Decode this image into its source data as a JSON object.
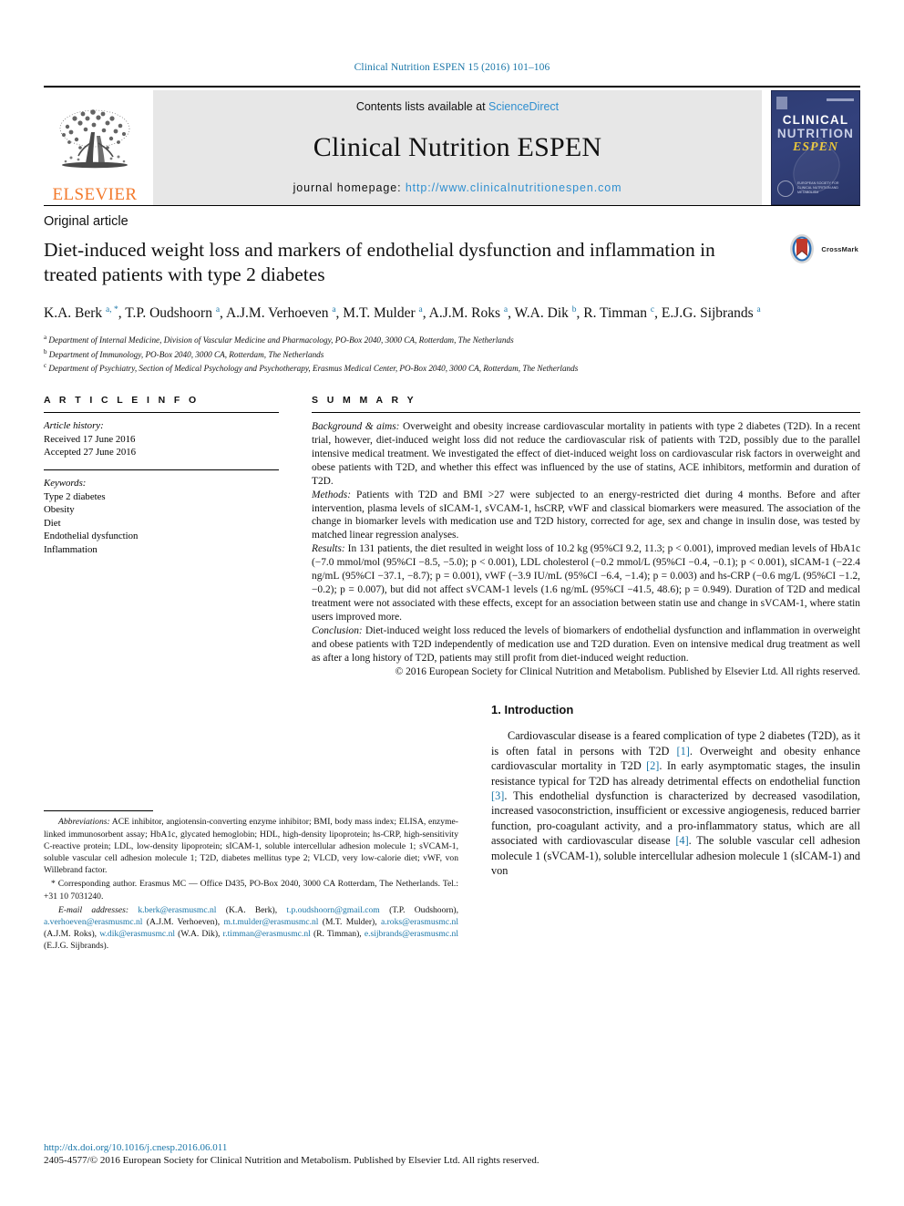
{
  "running_head": "Clinical Nutrition ESPEN 15 (2016) 101–106",
  "masthead": {
    "contents_prefix": "Contents lists available at ",
    "sciencedirect": "ScienceDirect",
    "journal_title": "Clinical Nutrition ESPEN",
    "homepage_prefix": "journal homepage: ",
    "homepage_url": "http://www.clinicalnutritionespen.com",
    "elsevier_wordmark": "ELSEVIER",
    "cover": {
      "line1": "CLINICAL",
      "line2": "NUTRITION",
      "line3": "ESPEN",
      "footer": "EUROPEAN SOCIETY FOR CLINICAL NUTRITION AND METABOLISM"
    },
    "link_color": "#2f8fd0"
  },
  "article": {
    "type": "Original article",
    "title": "Diet-induced weight loss and markers of endothelial dysfunction and inflammation in treated patients with type 2 diabetes",
    "crossmark_label": "CrossMark",
    "authors_html": "K.A. Berk <sup>a, *</sup>, T.P. Oudshoorn <sup>a</sup>, A.J.M. Verhoeven <sup>a</sup>, M.T. Mulder <sup>a</sup>, A.J.M. Roks <sup>a</sup>, W.A. Dik <sup>b</sup>, R. Timman <sup>c</sup>, E.J.G. Sijbrands <sup>a</sup>",
    "affiliations": [
      {
        "mark": "a",
        "text": "Department of Internal Medicine, Division of Vascular Medicine and Pharmacology, PO-Box 2040, 3000 CA, Rotterdam, The Netherlands"
      },
      {
        "mark": "b",
        "text": "Department of Immunology, PO-Box 2040, 3000 CA, Rotterdam, The Netherlands"
      },
      {
        "mark": "c",
        "text": "Department of Psychiatry, Section of Medical Psychology and Psychotherapy, Erasmus Medical Center, PO-Box 2040, 3000 CA, Rotterdam, The Netherlands"
      }
    ]
  },
  "article_info": {
    "heading": "A R T I C L E   I N F O",
    "history_label": "Article history:",
    "received": "Received 17 June 2016",
    "accepted": "Accepted 27 June 2016",
    "keywords_label": "Keywords:",
    "keywords": [
      "Type 2 diabetes",
      "Obesity",
      "Diet",
      "Endothelial dysfunction",
      "Inflammation"
    ]
  },
  "summary": {
    "heading": "S U M M A R Y",
    "background_label": "Background & aims:",
    "background_text": " Overweight and obesity increase cardiovascular mortality in patients with type 2 diabetes (T2D). In a recent trial, however, diet-induced weight loss did not reduce the cardiovascular risk of patients with T2D, possibly due to the parallel intensive medical treatment. We investigated the effect of diet-induced weight loss on cardiovascular risk factors in overweight and obese patients with T2D, and whether this effect was influenced by the use of statins, ACE inhibitors, metformin and duration of T2D.",
    "methods_label": "Methods:",
    "methods_text": " Patients with T2D and BMI >27 were subjected to an energy-restricted diet during 4 months. Before and after intervention, plasma levels of sICAM-1, sVCAM-1, hsCRP, vWF and classical biomarkers were measured. The association of the change in biomarker levels with medication use and T2D history, corrected for age, sex and change in insulin dose, was tested by matched linear regression analyses.",
    "results_label": "Results:",
    "results_text": " In 131 patients, the diet resulted in weight loss of 10.2 kg (95%CI 9.2, 11.3; p < 0.001), improved median levels of HbA1c (−7.0 mmol/mol (95%CI −8.5, −5.0); p < 0.001), LDL cholesterol (−0.2 mmol/L (95%CI −0.4, −0.1); p < 0.001), sICAM-1 (−22.4 ng/mL (95%CI −37.1, −8.7); p = 0.001), vWF (−3.9 IU/mL (95%CI −6.4, −1.4); p = 0.003) and hs-CRP (−0.6 mg/L (95%CI −1.2, −0.2); p = 0.007), but did not affect sVCAM-1 levels (1.6 ng/mL (95%CI −41.5, 48.6); p = 0.949). Duration of T2D and medical treatment were not associated with these effects, except for an association between statin use and change in sVCAM-1, where statin users improved more.",
    "conclusion_label": "Conclusion:",
    "conclusion_text": " Diet-induced weight loss reduced the levels of biomarkers of endothelial dysfunction and inflammation in overweight and obese patients with T2D independently of medication use and T2D duration. Even on intensive medical drug treatment as well as after a long history of T2D, patients may still profit from diet-induced weight reduction.",
    "copyright": "© 2016 European Society for Clinical Nutrition and Metabolism. Published by Elsevier Ltd. All rights reserved."
  },
  "footnotes": {
    "abbreviations_label": "Abbreviations:",
    "abbreviations_text": " ACE inhibitor, angiotensin-converting enzyme inhibitor; BMI, body mass index; ELISA, enzyme-linked immunosorbent assay; HbA1c, glycated hemoglobin; HDL, high-density lipoprotein; hs-CRP, high-sensitivity C-reactive protein; LDL, low-density lipoprotein; sICAM-1, soluble intercellular adhesion molecule 1; sVCAM-1, soluble vascular cell adhesion molecule 1; T2D, diabetes mellitus type 2; VLCD, very low-calorie diet; vWF, von Willebrand factor.",
    "corresponding_text": "* Corresponding author. Erasmus MC — Office D435, PO-Box 2040, 3000 CA Rotterdam, The Netherlands. Tel.: +31 10 7031240.",
    "email_label": "E-mail addresses:",
    "emails": [
      {
        "address": "k.berk@erasmusmc.nl",
        "person": "(K.A. Berk)"
      },
      {
        "address": "t.p.oudshoorn@gmail.com",
        "person": "(T.P. Oudshoorn)"
      },
      {
        "address": "a.verhoeven@erasmusmc.nl",
        "person": "(A.J.M. Verhoeven)"
      },
      {
        "address": "m.t.mulder@erasmusmc.nl",
        "person": "(M.T. Mulder)"
      },
      {
        "address": "a.roks@erasmusmc.nl",
        "person": "(A.J.M. Roks)"
      },
      {
        "address": "w.dik@erasmusmc.nl",
        "person": "(W.A. Dik)"
      },
      {
        "address": "r.timman@erasmusmc.nl",
        "person": "(R. Timman)"
      },
      {
        "address": "e.sijbrands@erasmusmc.nl",
        "person": "(E.J.G. Sijbrands)"
      }
    ]
  },
  "introduction": {
    "heading": "1. Introduction",
    "paragraph_parts": [
      "Cardiovascular disease is a feared complication of type 2 diabetes (T2D), as it is often fatal in persons with T2D ",
      "[1]",
      ". Overweight and obesity enhance cardiovascular mortality in T2D ",
      "[2]",
      ". In early asymptomatic stages, the insulin resistance typical for T2D has already detrimental effects on endothelial function ",
      "[3]",
      ". This endothelial dysfunction is characterized by decreased vasodilation, increased vasoconstriction, insufficient or excessive angiogenesis, reduced barrier function, pro-coagulant activity, and a pro-inflammatory status, which are all associated with cardiovascular disease ",
      "[4]",
      ". The soluble vascular cell adhesion molecule 1 (sVCAM-1), soluble intercellular adhesion molecule 1 (sICAM-1) and von"
    ]
  },
  "bottom": {
    "doi": "http://dx.doi.org/10.1016/j.cnesp.2016.06.011",
    "issn_line": "2405-4577/© 2016 European Society for Clinical Nutrition and Metabolism. Published by Elsevier Ltd. All rights reserved."
  }
}
